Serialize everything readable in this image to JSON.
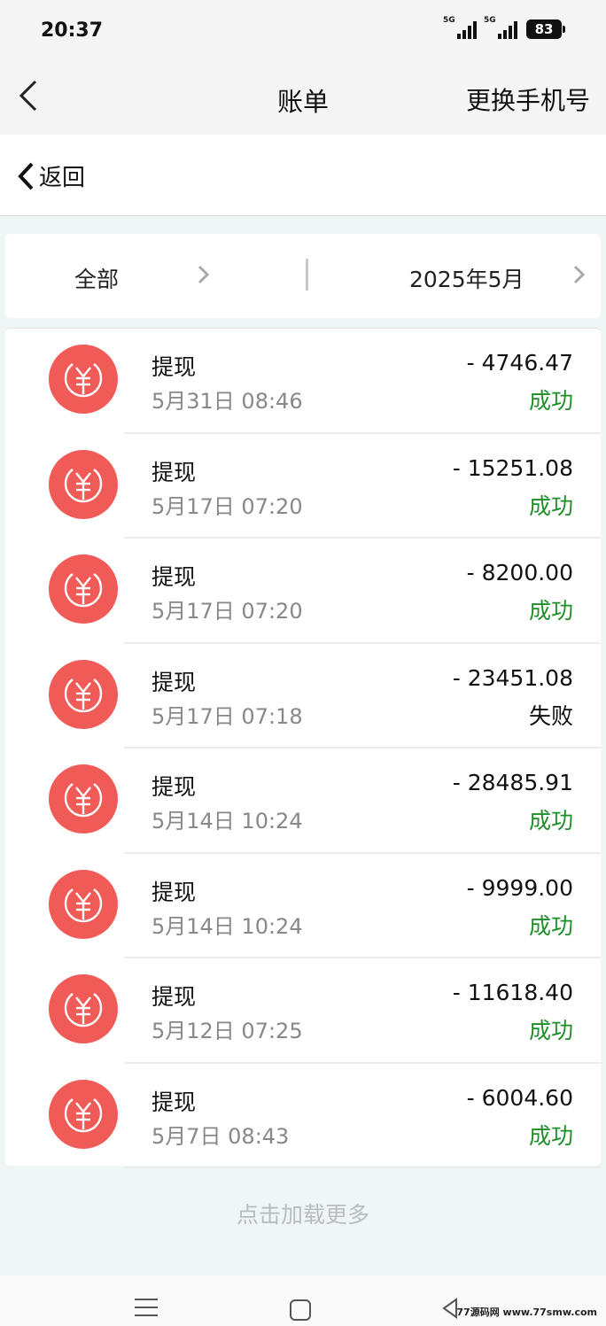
{
  "status_bar": {
    "time": "20:37",
    "network_1": "5G",
    "network_2": "5G",
    "battery": "83"
  },
  "nav": {
    "title": "账单",
    "action_label": "更换手机号",
    "back_icon": "chevron-left-icon"
  },
  "subheader": {
    "back_label": "返回"
  },
  "filter": {
    "category_label": "全部",
    "month_label": "2025年5月"
  },
  "colors": {
    "coin": "#f05a57",
    "success": "#1f8f2a",
    "failure": "#111111"
  },
  "transactions": [
    {
      "title": "提现",
      "date": "5月31日 08:46",
      "amount": "- 4746.47",
      "status": "成功",
      "state": "ok"
    },
    {
      "title": "提现",
      "date": "5月17日 07:20",
      "amount": "- 15251.08",
      "status": "成功",
      "state": "ok"
    },
    {
      "title": "提现",
      "date": "5月17日 07:20",
      "amount": "- 8200.00",
      "status": "成功",
      "state": "ok"
    },
    {
      "title": "提现",
      "date": "5月17日 07:18",
      "amount": "- 23451.08",
      "status": "失败",
      "state": "fail"
    },
    {
      "title": "提现",
      "date": "5月14日 10:24",
      "amount": "- 28485.91",
      "status": "成功",
      "state": "ok"
    },
    {
      "title": "提现",
      "date": "5月14日 10:24",
      "amount": "- 9999.00",
      "status": "成功",
      "state": "ok"
    },
    {
      "title": "提现",
      "date": "5月12日 07:25",
      "amount": "- 11618.40",
      "status": "成功",
      "state": "ok"
    },
    {
      "title": "提现",
      "date": "5月7日 08:43",
      "amount": "- 6004.60",
      "status": "成功",
      "state": "ok"
    }
  ],
  "load_more_label": "点击加载更多",
  "watermark": "77源码网 www.77smw.com"
}
